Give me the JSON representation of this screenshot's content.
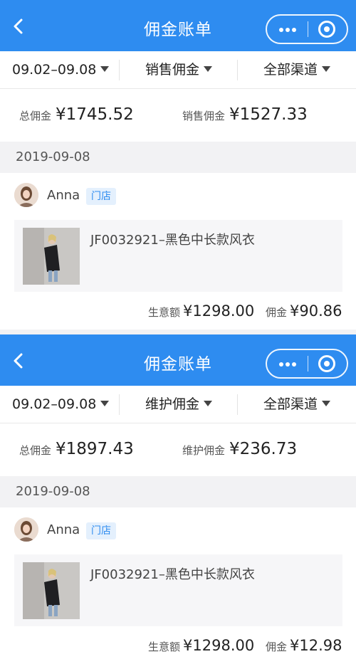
{
  "screens": [
    {
      "nav": {
        "title": "佣金账单"
      },
      "filters": {
        "date": "09.02–09.08",
        "type": "销售佣金",
        "channel": "全部渠道"
      },
      "summary": {
        "total_label": "总佣金",
        "total_value": "¥1745.52",
        "sub_label": "销售佣金",
        "sub_value": "¥1527.33"
      },
      "date_header": "2019-09-08",
      "record": {
        "user": "Anna",
        "tag": "门店",
        "product": "JF0032921–黑色中长款风衣",
        "revenue_label": "生意额",
        "revenue_value": "¥1298.00",
        "commission_label": "佣金",
        "commission_value": "¥90.86"
      }
    },
    {
      "nav": {
        "title": "佣金账单"
      },
      "filters": {
        "date": "09.02–09.08",
        "type": "维护佣金",
        "channel": "全部渠道"
      },
      "summary": {
        "total_label": "总佣金",
        "total_value": "¥1897.43",
        "sub_label": "维护佣金",
        "sub_value": "¥236.73"
      },
      "date_header": "2019-09-08",
      "record": {
        "user": "Anna",
        "tag": "门店",
        "product": "JF0032921–黑色中长款风衣",
        "revenue_label": "生意额",
        "revenue_value": "¥1298.00",
        "commission_label": "佣金",
        "commission_value": "¥12.98"
      }
    }
  ],
  "icons": {
    "back": "chevron-left-icon",
    "more": "more-dots-icon",
    "close": "miniprogram-close-icon",
    "dropdown": "caret-down-icon"
  },
  "colors": {
    "nav_bg": "#2e8cf0",
    "tag_text": "#2e8cf0",
    "tag_bg": "#e4f0fd",
    "page_bg": "#f2f2f4"
  }
}
